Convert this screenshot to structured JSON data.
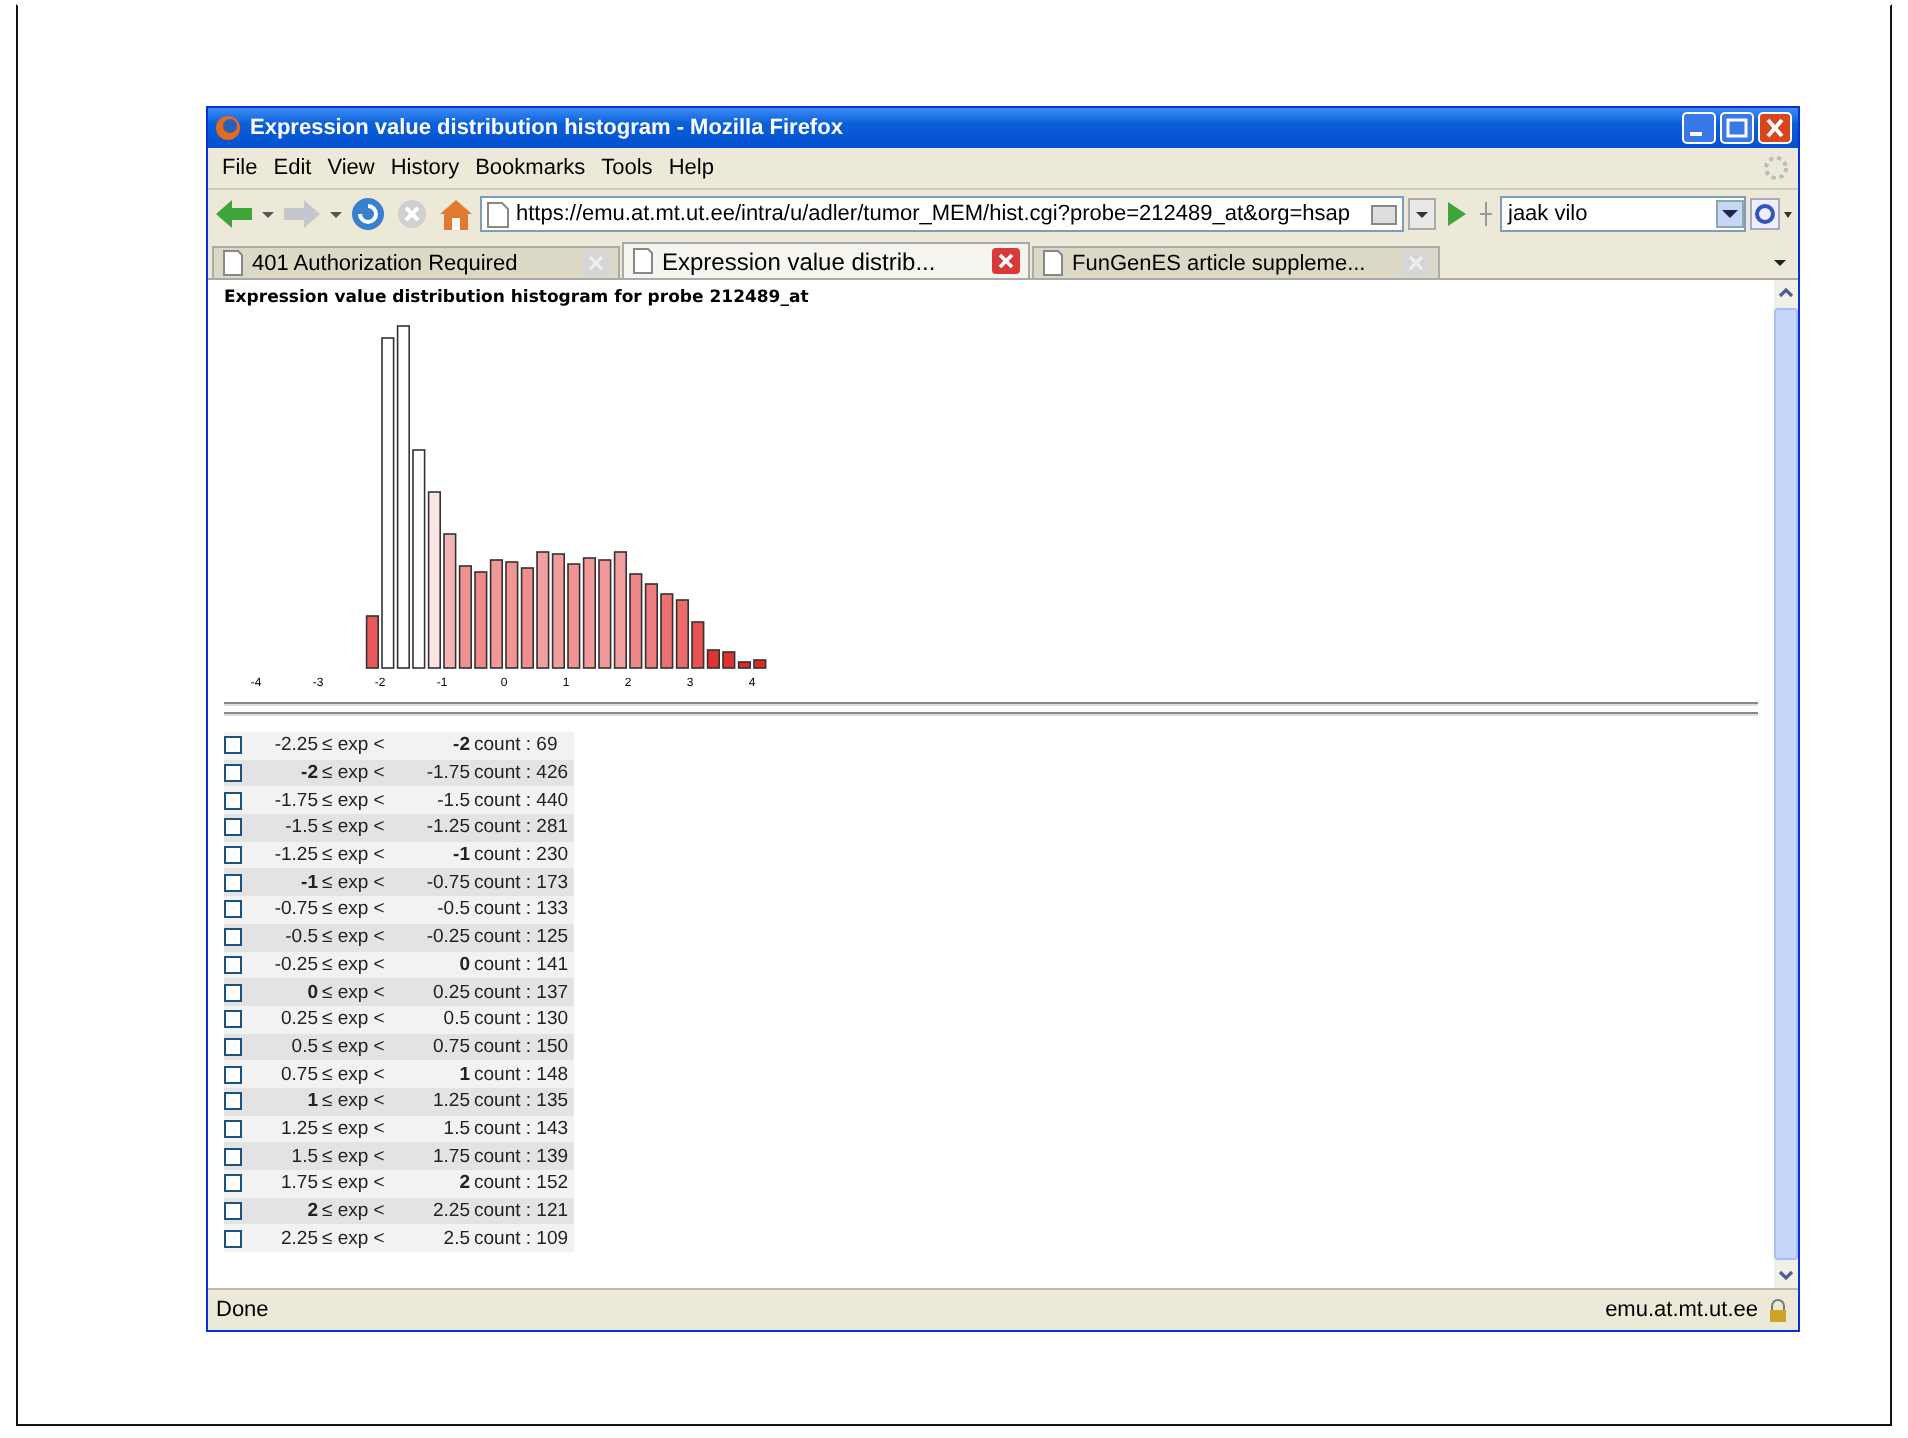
{
  "window": {
    "title": "Expression value distribution histogram - Mozilla Firefox"
  },
  "menu_bar": [
    "File",
    "Edit",
    "View",
    "History",
    "Bookmarks",
    "Tools",
    "Help"
  ],
  "toolbar": {
    "url": "https://emu.at.mt.ut.ee/intra/u/adler/tumor_MEM/hist.cgi?probe=212489_at&org=hsap",
    "search_value": "jaak vilo"
  },
  "tabs": [
    {
      "label": "401 Authorization Required",
      "selected": false
    },
    {
      "label": "Expression value distrib...",
      "selected": true
    },
    {
      "label": "FunGenES article suppleme...",
      "selected": false
    }
  ],
  "page": {
    "heading": "Expression value distribution histogram for probe 212489_at",
    "histogram": {
      "x_tick_labels": [
        "-4",
        "-3",
        "-2",
        "-1",
        "0",
        "1",
        "2",
        "3",
        "4"
      ]
    },
    "bins": [
      {
        "checked": false,
        "low": "-2.25",
        "relation": "≤ exp <",
        "high": "**-2**",
        "count": "count : 69"
      },
      {
        "checked": false,
        "low": "**-2**",
        "relation": "≤ exp <",
        "high": "-1.75",
        "count": "count : 426"
      },
      {
        "checked": false,
        "low": "-1.75",
        "relation": "≤ exp <",
        "high": "-1.5",
        "count": "count : 440"
      },
      {
        "checked": false,
        "low": "-1.5",
        "relation": "≤ exp <",
        "high": "-1.25",
        "count": "count : 281"
      },
      {
        "checked": false,
        "low": "-1.25",
        "relation": "≤ exp <",
        "high": "**-1**",
        "count": "count : 230"
      },
      {
        "checked": false,
        "low": "**-1**",
        "relation": "≤ exp <",
        "high": "-0.75",
        "count": "count : 173"
      },
      {
        "checked": false,
        "low": "-0.75",
        "relation": "≤ exp <",
        "high": "-0.5",
        "count": "count : 133"
      },
      {
        "checked": false,
        "low": "-0.5",
        "relation": "≤ exp <",
        "high": "-0.25",
        "count": "count : 125"
      },
      {
        "checked": false,
        "low": "-0.25",
        "relation": "≤ exp <",
        "high": "**0**",
        "count": "count : 141"
      },
      {
        "checked": false,
        "low": "**0**",
        "relation": "≤ exp <",
        "high": "0.25",
        "count": "count : 137"
      },
      {
        "checked": false,
        "low": "0.25",
        "relation": "≤ exp <",
        "high": "0.5",
        "count": "count : 130"
      },
      {
        "checked": false,
        "low": "0.5",
        "relation": "≤ exp <",
        "high": "0.75",
        "count": "count : 150"
      },
      {
        "checked": false,
        "low": "0.75",
        "relation": "≤ exp <",
        "high": "**1**",
        "count": "count : 148"
      },
      {
        "checked": false,
        "low": "**1**",
        "relation": "≤ exp <",
        "high": "1.25",
        "count": "count : 135"
      },
      {
        "checked": false,
        "low": "1.25",
        "relation": "≤ exp <",
        "high": "1.5",
        "count": "count : 143"
      },
      {
        "checked": false,
        "low": "1.5",
        "relation": "≤ exp <",
        "high": "1.75",
        "count": "count : 139"
      },
      {
        "checked": false,
        "low": "1.75",
        "relation": "≤ exp <",
        "high": "**2**",
        "count": "count : 152"
      },
      {
        "checked": false,
        "low": "**2**",
        "relation": "≤ exp <",
        "high": "2.25",
        "count": "count : 121"
      },
      {
        "checked": false,
        "low": "2.25",
        "relation": "≤ exp <",
        "high": "2.5",
        "count": "count : 109"
      }
    ]
  },
  "status_bar": {
    "text": "Done",
    "host": "emu.at.mt.ut.ee"
  }
}
